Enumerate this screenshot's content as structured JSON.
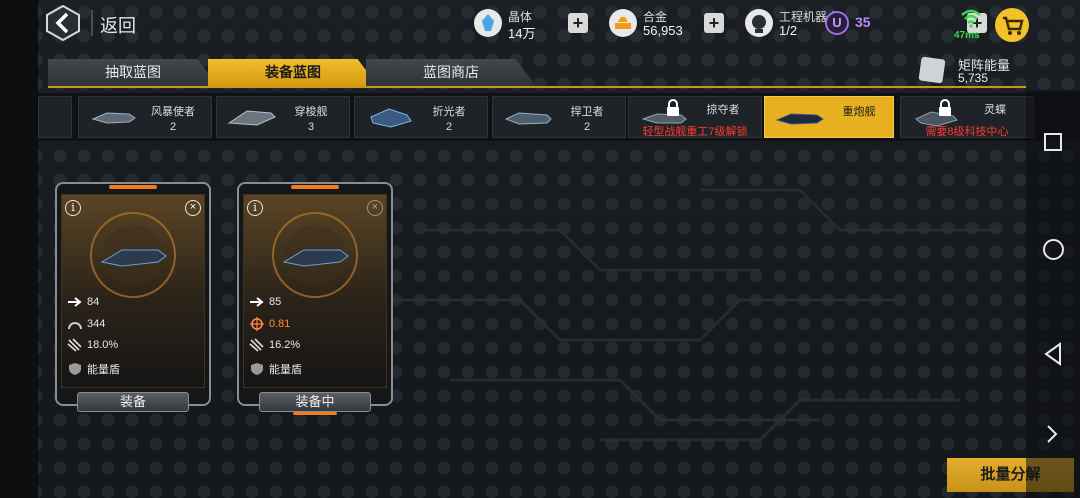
{
  "topbar": {
    "back_label": "返回",
    "crystal": {
      "label": "晶体",
      "value": "14万",
      "color": "#4aa6e8"
    },
    "alloy": {
      "label": "合金",
      "value": "56,953",
      "color": "#f39a1b"
    },
    "robot": {
      "label": "工程机器人",
      "value": "1/2"
    },
    "u_letter": "U",
    "u_value": "35",
    "ping": "47ms"
  },
  "tabs": [
    {
      "label": "抽取蓝图",
      "active": false
    },
    {
      "label": "装备蓝图",
      "active": true
    },
    {
      "label": "蓝图商店",
      "active": false
    }
  ],
  "matrix": {
    "label": "矩阵能量",
    "value": "5,735"
  },
  "ships": [
    {
      "name": "风暴使者",
      "count": "2"
    },
    {
      "name": "穿梭舰",
      "count": "3"
    },
    {
      "name": "折光者",
      "count": "2"
    },
    {
      "name": "捍卫者",
      "count": "2"
    },
    {
      "name": "掠夺者",
      "lock_text": "轻型战舰重工7级解锁"
    },
    {
      "name": "重炮舰",
      "selected": true
    },
    {
      "name": "灵蝶",
      "lock_text": "需要8级科技中心"
    }
  ],
  "cards": [
    {
      "stats": [
        {
          "icon": "speed-arrow-icon",
          "value": "84"
        },
        {
          "icon": "armor-gauge-icon",
          "value": "344"
        },
        {
          "icon": "missile-cluster-icon",
          "value": "18.0%"
        },
        {
          "icon": "shield-icon",
          "value": "能量盾"
        }
      ],
      "button": "装备"
    },
    {
      "stats": [
        {
          "icon": "speed-arrow-icon",
          "value": "85"
        },
        {
          "icon": "crosshair-icon",
          "value": "0.81"
        },
        {
          "icon": "missile-cluster-icon",
          "value": "16.2%"
        },
        {
          "icon": "shield-icon",
          "value": "能量盾"
        }
      ],
      "button": "装备中"
    }
  ],
  "batch_button": "批量分解",
  "colors": {
    "accent": "#e7b021",
    "lock_red": "#ff3b30",
    "ping_green": "#3bd94c",
    "purple": "#b888f5"
  }
}
